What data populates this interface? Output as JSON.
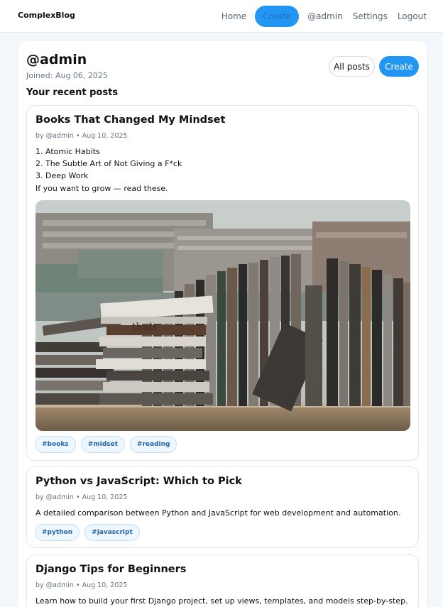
{
  "navbar": {
    "brand": "ComplexBlog",
    "links": {
      "home": "Home",
      "create": "Create",
      "profile": "@admin",
      "settings": "Settings",
      "logout": "Logout"
    }
  },
  "profile": {
    "username": "@admin",
    "joined": "Joined: Aug 06, 2025",
    "all_posts_label": "All posts",
    "create_label": "Create",
    "section_title": "Your recent posts"
  },
  "posts": [
    {
      "title": "Books That Changed My Mindset",
      "meta": "by @admin • Aug 10, 2025",
      "body": [
        "1. Atomic Habits",
        "2. The Subtle Art of Not Giving a F*ck",
        "3. Deep Work",
        "If you want to grow — read these."
      ],
      "image_book_label": "thuis",
      "tags": [
        "#books",
        "#midset",
        "#reading"
      ]
    },
    {
      "title": "Python vs JavaScript: Which to Pick",
      "meta": "by @admin • Aug 10, 2025",
      "body": [
        "A detailed comparison between Python and JavaScript for web development and automation."
      ],
      "tags": [
        "#python",
        "#javascript"
      ]
    },
    {
      "title": "Django Tips for Beginners",
      "meta": "by @admin • Aug 10, 2025",
      "body": [
        "Learn how to build your first Django project, set up views, templates, and models step-by-step."
      ],
      "tags": []
    }
  ],
  "colors": {
    "accent": "#2196f3",
    "tag_bg": "#eef6fe",
    "tag_text": "#2567a8"
  }
}
